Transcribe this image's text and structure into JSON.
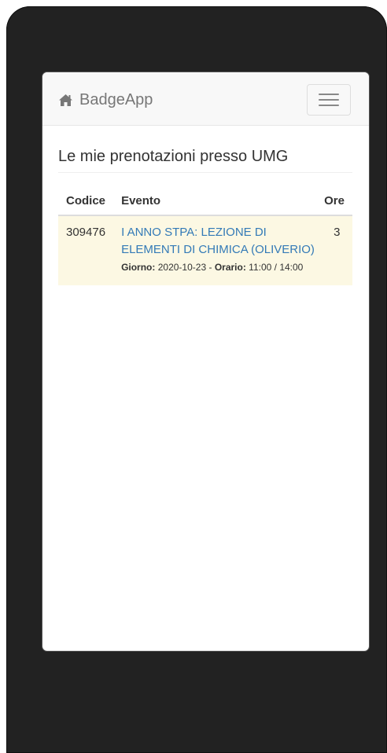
{
  "navbar": {
    "brand_label": "BadgeApp",
    "brand_icon": "home-icon",
    "toggle_icon": "hamburger-icon"
  },
  "page": {
    "title": "Le mie prenotazioni presso UMG"
  },
  "table": {
    "headers": [
      "Codice",
      "Evento",
      "Ore"
    ],
    "rows": [
      {
        "codice": "309476",
        "evento_title": "I ANNO STPA: LEZIONE DI ELEMENTI DI CHIMICA (OLIVERIO)",
        "giorno_label": "Giorno:",
        "giorno_value": "2020-10-23",
        "separator": "-",
        "orario_label": "Orario:",
        "orario_value": "11:00 / 14:00",
        "ore": "3"
      }
    ]
  },
  "colors": {
    "link": "#337ab7",
    "row_warning": "#fcf8e3",
    "device_frame": "#222222"
  }
}
